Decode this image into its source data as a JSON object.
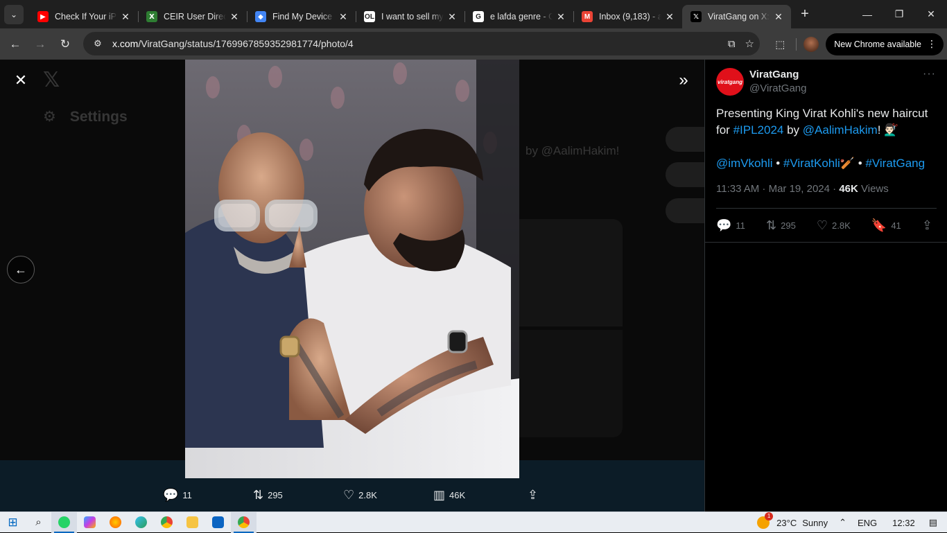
{
  "browser": {
    "tabs": [
      {
        "title": "Check If Your iPh",
        "favicon": "youtube-icon",
        "color": "#ff0000",
        "glyph": "▶"
      },
      {
        "title": "CEIR User Direct",
        "favicon": "ceir-icon",
        "color": "#2e7d32",
        "glyph": "Ⅹ"
      },
      {
        "title": "Find My Device",
        "favicon": "find-my-device-icon",
        "color": "#4285f4",
        "glyph": "◆"
      },
      {
        "title": "I want to sell my",
        "favicon": "olx-icon",
        "color": "#ffffff",
        "glyph": "OL"
      },
      {
        "title": "e lafda genre - G",
        "favicon": "google-icon",
        "color": "#ffffff",
        "glyph": "G"
      },
      {
        "title": "Inbox (9,183) - a",
        "favicon": "gmail-icon",
        "color": "#ea4335",
        "glyph": "M"
      },
      {
        "title": "ViratGang on X:",
        "favicon": "x-icon",
        "color": "#000000",
        "glyph": "𝕏",
        "active": true
      }
    ],
    "url_host": "x.com",
    "url_path": "/ViratGang/status/1769967859352981774/photo/4",
    "update_label": "New Chrome available"
  },
  "media_viewer": {
    "background": {
      "settings_label": "Settings",
      "mention": "by @AalimHakim!"
    },
    "actions": {
      "replies": "11",
      "reposts": "295",
      "likes": "2.8K",
      "views": "46K"
    }
  },
  "tweet": {
    "display_name": "ViratGang",
    "handle": "@ViratGang",
    "avatar_text": "viratgang",
    "text_prefix": "Presenting King Virat Kohli's new haircut for ",
    "hashtag_ipl": "#IPL2024",
    "text_by": " by ",
    "mention_aalim": "@AalimHakim",
    "text_bang": "! 💇🏻‍♂️",
    "mention_vk": "@imVkohli",
    "sep1": " • ",
    "hashtag_vk": "#ViratKohli",
    "emoji_vk": "🏏",
    "sep2": " • ",
    "hashtag_vg": "#ViratGang",
    "time": "11:33 AM · Mar 19, 2024 · ",
    "views_count": "46K",
    "views_label": " Views",
    "replies": "11",
    "reposts": "295",
    "likes": "2.8K",
    "bookmarks": "41"
  },
  "taskbar": {
    "temperature": "23°C",
    "weather": "Sunny",
    "weather_badge": "1",
    "language": "ENG",
    "clock": "12:32"
  },
  "colors": {
    "accent": "#1d9bf0",
    "avatar": "#e0101a"
  }
}
